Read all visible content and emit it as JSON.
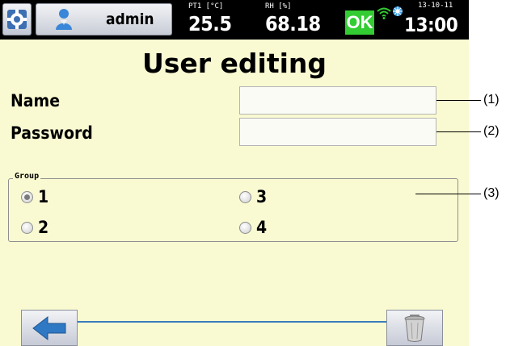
{
  "status_bar": {
    "user": "admin",
    "sensor1": {
      "label": "PT1 [°C]",
      "value": "25.5"
    },
    "sensor2": {
      "label": "RH [%]",
      "value": "68.18"
    },
    "status": "OK",
    "date": "13-10-11",
    "time": "13:00"
  },
  "page": {
    "title": "User editing",
    "fields": {
      "name_label": "Name",
      "name_value": "",
      "password_label": "Password",
      "password_value": ""
    },
    "group": {
      "legend": "Group",
      "selected": "1",
      "options": [
        "1",
        "2",
        "3",
        "4"
      ]
    }
  },
  "callouts": [
    "(1)",
    "(2)",
    "(3)"
  ],
  "colors": {
    "background": "#fafad2",
    "status_ok": "#33cc33",
    "accent_line": "#3a7bbd",
    "back_arrow": "#2f78c4"
  },
  "icons": {
    "settings": "settings-icon",
    "user": "user-icon",
    "wifi": "wifi-icon",
    "network": "network-icon",
    "back": "back-arrow-icon",
    "delete": "trash-icon"
  }
}
